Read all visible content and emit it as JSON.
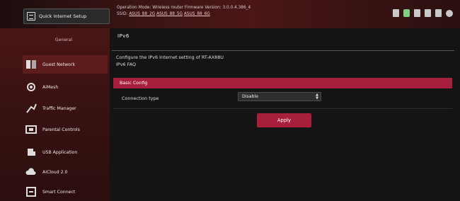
{
  "header": {
    "qis_label": "Quick Internet Setup",
    "status_line1": "Operation Mode: Wireless router   Firmware Version: 3.0.0.4.386_4",
    "status_line2_prefix": "SSID:",
    "status_links": [
      "ASUS_88_2G",
      "ASUS_88_5G",
      "ASUS_88_6G"
    ]
  },
  "sidebar": {
    "heading": "General",
    "items": [
      {
        "label": "Guest Network",
        "icon": "guest-network-icon"
      },
      {
        "label": "AiMesh",
        "icon": "aimesh-icon"
      },
      {
        "label": "Traffic Manager",
        "icon": "traffic-icon"
      },
      {
        "label": "Parental Controls",
        "icon": "parental-controls-icon"
      },
      {
        "label": "USB Application",
        "icon": "usb-icon"
      },
      {
        "label": "AiCloud 2.0",
        "icon": "cloud-icon"
      },
      {
        "label": "Smart Connect",
        "icon": "smart-connect-icon"
      }
    ]
  },
  "main": {
    "title": "IPv6",
    "desc_line1": "Configure the IPv6 Internet setting of RT-AX88U",
    "desc_line2": "IPv6 FAQ",
    "section": "Basic Config",
    "connection_label": "Connection type",
    "connection_value": "Disable",
    "apply_label": "Apply"
  }
}
